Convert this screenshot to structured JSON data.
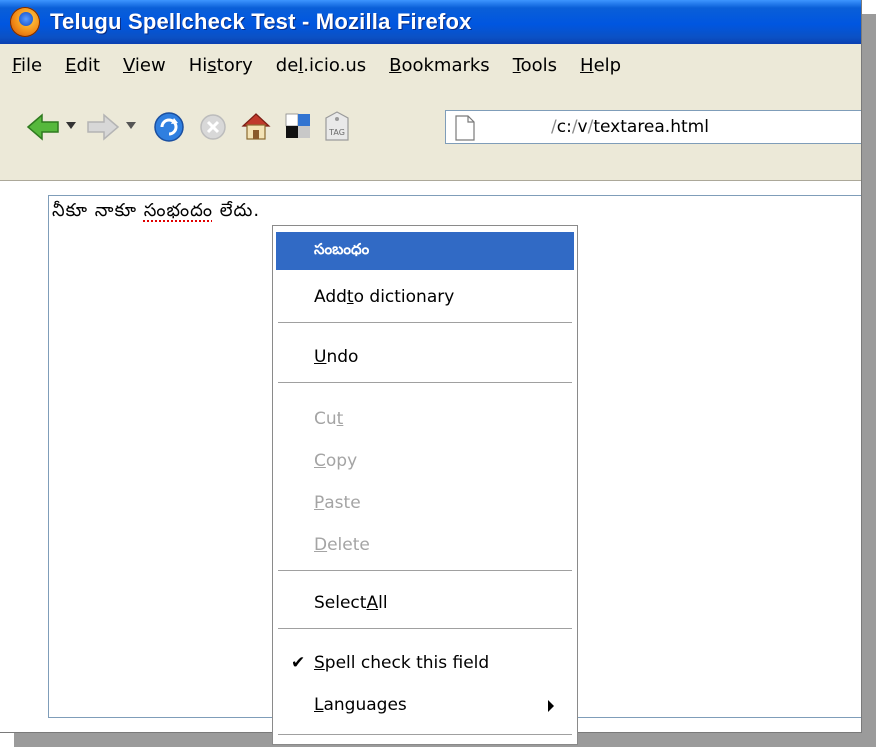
{
  "window": {
    "title": "Telugu Spellcheck Test - Mozilla Firefox"
  },
  "menubar": [
    {
      "label": "File",
      "accel": "F",
      "rest": "ile"
    },
    {
      "label": "Edit",
      "accel": "E",
      "rest": "dit"
    },
    {
      "label": "View",
      "accel": "V",
      "rest": "iew"
    },
    {
      "label": "History",
      "pre": "Hi",
      "accel": "s",
      "rest": "tory"
    },
    {
      "label": "del.icio.us",
      "pre": "de",
      "accel": "l",
      "rest": ".icio.us"
    },
    {
      "label": "Bookmarks",
      "accel": "B",
      "rest": "ookmarks"
    },
    {
      "label": "Tools",
      "accel": "T",
      "rest": "ools"
    },
    {
      "label": "Help",
      "accel": "H",
      "rest": "elp"
    }
  ],
  "toolbar": {
    "icons": [
      "back-arrow-icon",
      "back-dropdown-icon",
      "forward-arrow-icon",
      "forward-dropdown-icon",
      "reload-icon",
      "stop-icon",
      "home-icon",
      "delicious-icon",
      "tag-icon"
    ],
    "url": {
      "prefix": "/",
      "c": "c:",
      "sep1": "/",
      "v": "v",
      "sep2": "/",
      "file": "textarea.html"
    }
  },
  "textarea": {
    "before": "నీకూ నాకూ ",
    "misspelled": "సంభందం",
    "after": " లేదు."
  },
  "context_menu": {
    "suggestion": "సంబంధం",
    "add_dict": {
      "pre": "Add ",
      "accel": "t",
      "rest": "o dictionary"
    },
    "undo": {
      "pre": "",
      "accel": "U",
      "rest": "ndo"
    },
    "cut": {
      "pre": "Cu",
      "accel": "t",
      "rest": ""
    },
    "copy": {
      "pre": "",
      "accel": "C",
      "rest": "opy"
    },
    "paste": {
      "pre": "",
      "accel": "P",
      "rest": "aste"
    },
    "delete": {
      "pre": "",
      "accel": "D",
      "rest": "elete"
    },
    "select_all": {
      "pre": "Select ",
      "accel": "A",
      "rest": "ll"
    },
    "spellcheck": {
      "pre": "",
      "accel": "S",
      "rest": "pell check this field",
      "checked": true
    },
    "languages": {
      "pre": "",
      "accel": "L",
      "rest": "anguages"
    }
  },
  "colors": {
    "title_blue": "#0056e0",
    "highlight": "#316ac5",
    "misspell": "#e00000"
  }
}
